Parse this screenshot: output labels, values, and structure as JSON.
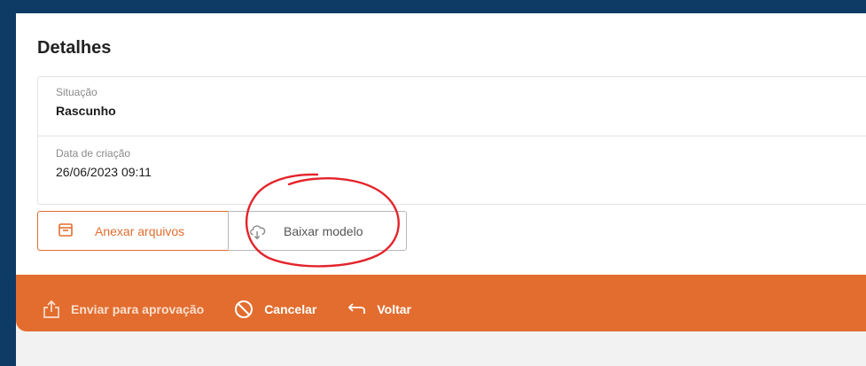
{
  "details": {
    "title": "Detalhes",
    "fields": [
      {
        "label": "Situação",
        "value": "Rascunho"
      },
      {
        "label": "Data de criação",
        "value": "26/06/2023 09:11"
      }
    ]
  },
  "buttons": {
    "attach_label": "Anexar arquivos",
    "download_label": "Baixar modelo"
  },
  "actions": {
    "send_label": "Enviar para aprovação",
    "cancel_label": "Cancelar",
    "back_label": "Voltar"
  },
  "colors": {
    "accent": "#e26d2f",
    "background": "#0e3a66",
    "annotation": "#e3242b"
  },
  "icons": {
    "attach": "attach-box-icon",
    "download": "cloud-download-icon",
    "send": "share-upload-icon",
    "cancel": "cancel-circle-icon",
    "back": "back-arrow-icon"
  }
}
